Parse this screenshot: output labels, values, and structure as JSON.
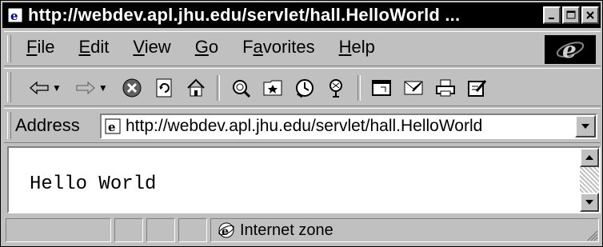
{
  "window": {
    "title": "http://webdev.apl.jhu.edu/servlet/hall.HelloWorld ..."
  },
  "menu": {
    "items": [
      {
        "label": "File",
        "hotkey": "F",
        "rest": "ile"
      },
      {
        "label": "Edit",
        "hotkey": "E",
        "rest": "dit"
      },
      {
        "label": "View",
        "hotkey": "V",
        "rest": "iew"
      },
      {
        "label": "Go",
        "hotkey": "G",
        "rest": "o"
      },
      {
        "label": "Favorites",
        "pre": "F",
        "hotkey": "a",
        "rest": "vorites"
      },
      {
        "label": "Help",
        "hotkey": "H",
        "rest": "elp"
      }
    ]
  },
  "toolbar": {
    "icons": [
      "back-icon",
      "forward-icon",
      "stop-icon",
      "refresh-icon",
      "home-icon",
      "search-icon",
      "favorites-icon",
      "history-icon",
      "channels-icon",
      "fullscreen-icon",
      "mail-icon",
      "print-icon",
      "edit-icon"
    ]
  },
  "address": {
    "label": "Address",
    "url": "http://webdev.apl.jhu.edu/servlet/hall.HelloWorld"
  },
  "page": {
    "text": "Hello World"
  },
  "status": {
    "zone": "Internet zone"
  }
}
